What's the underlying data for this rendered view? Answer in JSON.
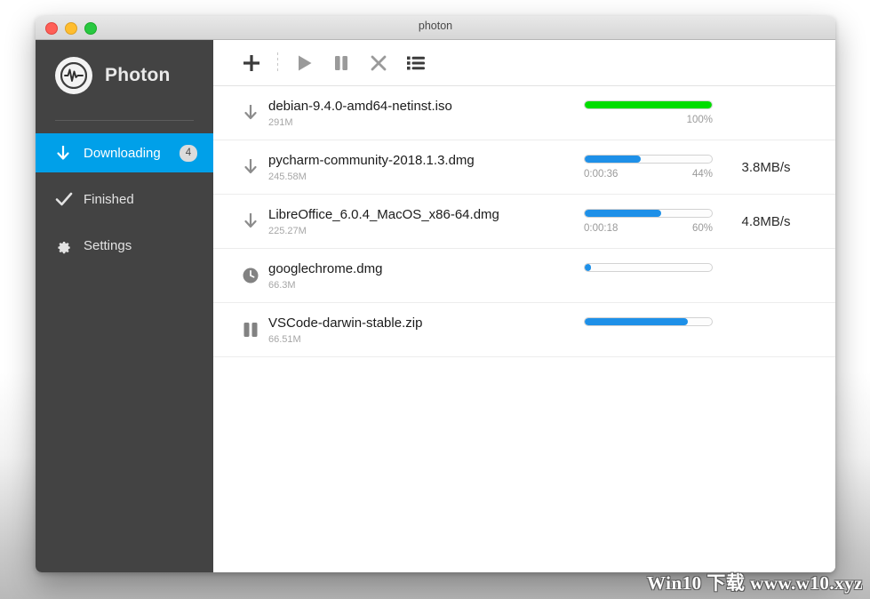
{
  "window": {
    "title": "photon",
    "controls": [
      {
        "name": "close",
        "color": "#ff5f57"
      },
      {
        "name": "minimize",
        "color": "#ffbd2e"
      },
      {
        "name": "zoom",
        "color": "#28c840"
      }
    ]
  },
  "sidebar": {
    "brand": "Photon",
    "logo_icon": "waveform-circle-icon",
    "items": [
      {
        "label": "Downloading",
        "icon": "download-arrow-icon",
        "badge": "4",
        "active": true
      },
      {
        "label": "Finished",
        "icon": "check-icon",
        "badge": "",
        "active": false
      },
      {
        "label": "Settings",
        "icon": "gear-icon",
        "badge": "",
        "active": false
      }
    ]
  },
  "toolbar": {
    "buttons": [
      {
        "name": "add-download-button",
        "icon": "plus-icon",
        "label": "Add"
      },
      {
        "name": "resume-button",
        "icon": "play-icon",
        "label": "Resume"
      },
      {
        "name": "pause-button",
        "icon": "pause-icon",
        "label": "Pause"
      },
      {
        "name": "remove-button",
        "icon": "close-x-icon",
        "label": "Remove"
      },
      {
        "name": "list-view-button",
        "icon": "list-icon",
        "label": "List"
      }
    ]
  },
  "downloads": [
    {
      "filename": "debian-9.4.0-amd64-netinst.iso",
      "size": "291M",
      "status_icon": "download-arrow-icon",
      "percent": 100,
      "percent_label": "100%",
      "time_label": "",
      "speed": "",
      "bar_color": "#00dd00"
    },
    {
      "filename": "pycharm-community-2018.1.3.dmg",
      "size": "245.58M",
      "status_icon": "download-arrow-icon",
      "percent": 44,
      "percent_label": "44%",
      "time_label": "0:00:36",
      "speed": "3.8MB/s",
      "bar_color": "#1e90e8"
    },
    {
      "filename": "LibreOffice_6.0.4_MacOS_x86-64.dmg",
      "size": "225.27M",
      "status_icon": "download-arrow-icon",
      "percent": 60,
      "percent_label": "60%",
      "time_label": "0:00:18",
      "speed": "4.8MB/s",
      "bar_color": "#1e90e8"
    },
    {
      "filename": "googlechrome.dmg",
      "size": "66.3M",
      "status_icon": "clock-icon",
      "percent": 5,
      "percent_label": "",
      "time_label": "",
      "speed": "",
      "bar_color": "#1e90e8"
    },
    {
      "filename": "VSCode-darwin-stable.zip",
      "size": "66.51M",
      "status_icon": "pause-icon",
      "percent": 81,
      "percent_label": "",
      "time_label": "",
      "speed": "",
      "bar_color": "#1e90e8"
    }
  ],
  "watermark": "Win10  下载 www.w10.xyz",
  "colors": {
    "sidebar_bg": "#434343",
    "accent_blue": "#00a0e9",
    "progress_blue": "#1e90e8",
    "progress_green": "#00dd00"
  }
}
